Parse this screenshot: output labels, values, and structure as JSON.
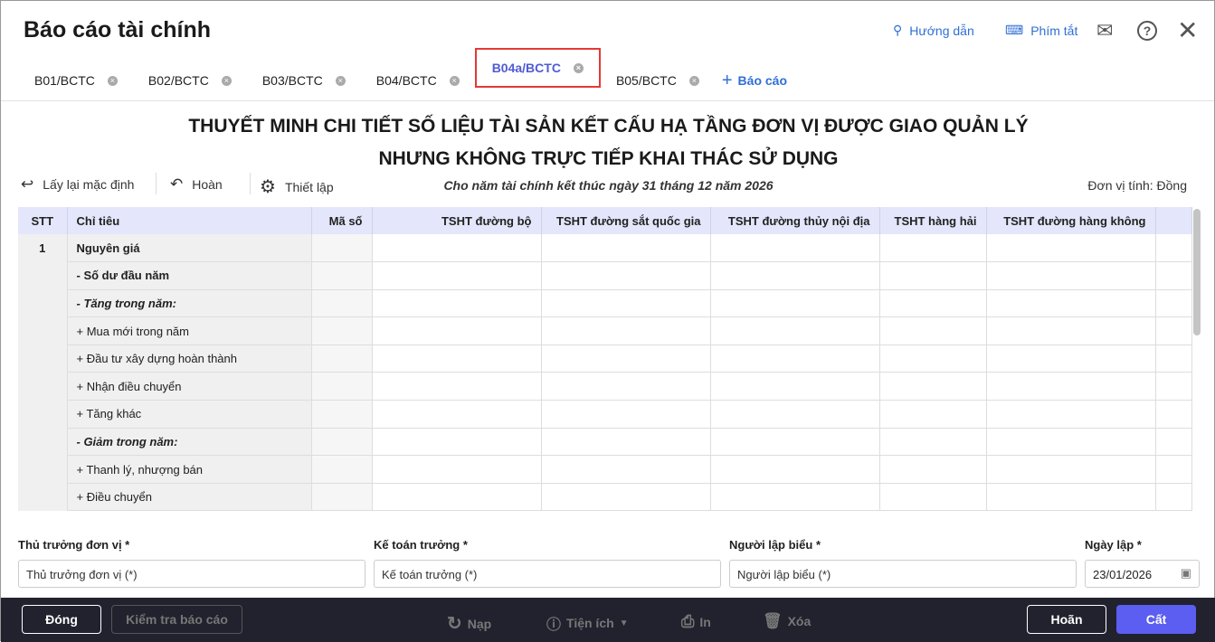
{
  "window": {
    "title": "Báo cáo tài chính",
    "help": "Hướng dẫn",
    "shortcuts": "Phím tắt"
  },
  "tabs": [
    {
      "label": "B01/BCTC"
    },
    {
      "label": "B02/BCTC"
    },
    {
      "label": "B03/BCTC"
    },
    {
      "label": "B04/BCTC"
    },
    {
      "label": "B04a/BCTC",
      "active": true
    },
    {
      "label": "B05/BCTC"
    }
  ],
  "add_tab": "Báo cáo",
  "report": {
    "title1": "THUYẾT MINH CHI TIẾT SỐ LIỆU TÀI SẢN KẾT CẤU HẠ TẦNG ĐƠN VỊ ĐƯỢC GIAO QUẢN LÝ",
    "title2": "NHƯNG KHÔNG TRỰC TIẾP KHAI THÁC SỬ DỤNG",
    "subtitle": "Cho năm tài chính kết thúc ngày 31 tháng 12 năm 2026",
    "unit": "Đơn vị tính: Đồng"
  },
  "toolbar": {
    "reset": "Lấy lại mặc định",
    "undo": "Hoàn",
    "settings": "Thiết lập"
  },
  "table": {
    "headers": [
      "STT",
      "Chỉ tiêu",
      "Mã số",
      "TSHT đường bộ",
      "TSHT đường sắt quốc gia",
      "TSHT đường thủy nội địa",
      "TSHT hàng hải",
      "TSHT đường hàng không"
    ],
    "rows": [
      {
        "stt": "1",
        "label": "Nguyên giá",
        "style": "bold"
      },
      {
        "stt": "",
        "label": "- Số dư đầu năm",
        "style": "bold"
      },
      {
        "stt": "",
        "label": "- Tăng trong năm:",
        "style": "bolditalic"
      },
      {
        "stt": "",
        "label": "+ Mua mới trong năm",
        "style": ""
      },
      {
        "stt": "",
        "label": "+ Đầu tư xây dựng hoàn thành",
        "style": ""
      },
      {
        "stt": "",
        "label": "+ Nhận điều chuyển",
        "style": ""
      },
      {
        "stt": "",
        "label": "+ Tăng khác",
        "style": ""
      },
      {
        "stt": "",
        "label": "- Giảm trong năm:",
        "style": "bolditalic"
      },
      {
        "stt": "",
        "label": "+ Thanh lý, nhượng bán",
        "style": ""
      },
      {
        "stt": "",
        "label": "+ Điều chuyển",
        "style": ""
      }
    ]
  },
  "signers": {
    "head_label": "Thủ trưởng đơn vị *",
    "head_placeholder": "Thủ trưởng đơn vị (*)",
    "acc_label": "Kế toán trưởng *",
    "acc_placeholder": "Kế toán trưởng (*)",
    "maker_label": "Người lập biểu *",
    "maker_placeholder": "Người lập biểu (*)",
    "date_label": "Ngày lập *",
    "date_value": "23/01/2026"
  },
  "footer": {
    "close": "Đóng",
    "check": "Kiểm tra báo cáo",
    "reload": "Nạp",
    "utils": "Tiện ích",
    "print": "In",
    "delete": "Xóa",
    "undo": "Hoãn",
    "save": "Cất"
  }
}
